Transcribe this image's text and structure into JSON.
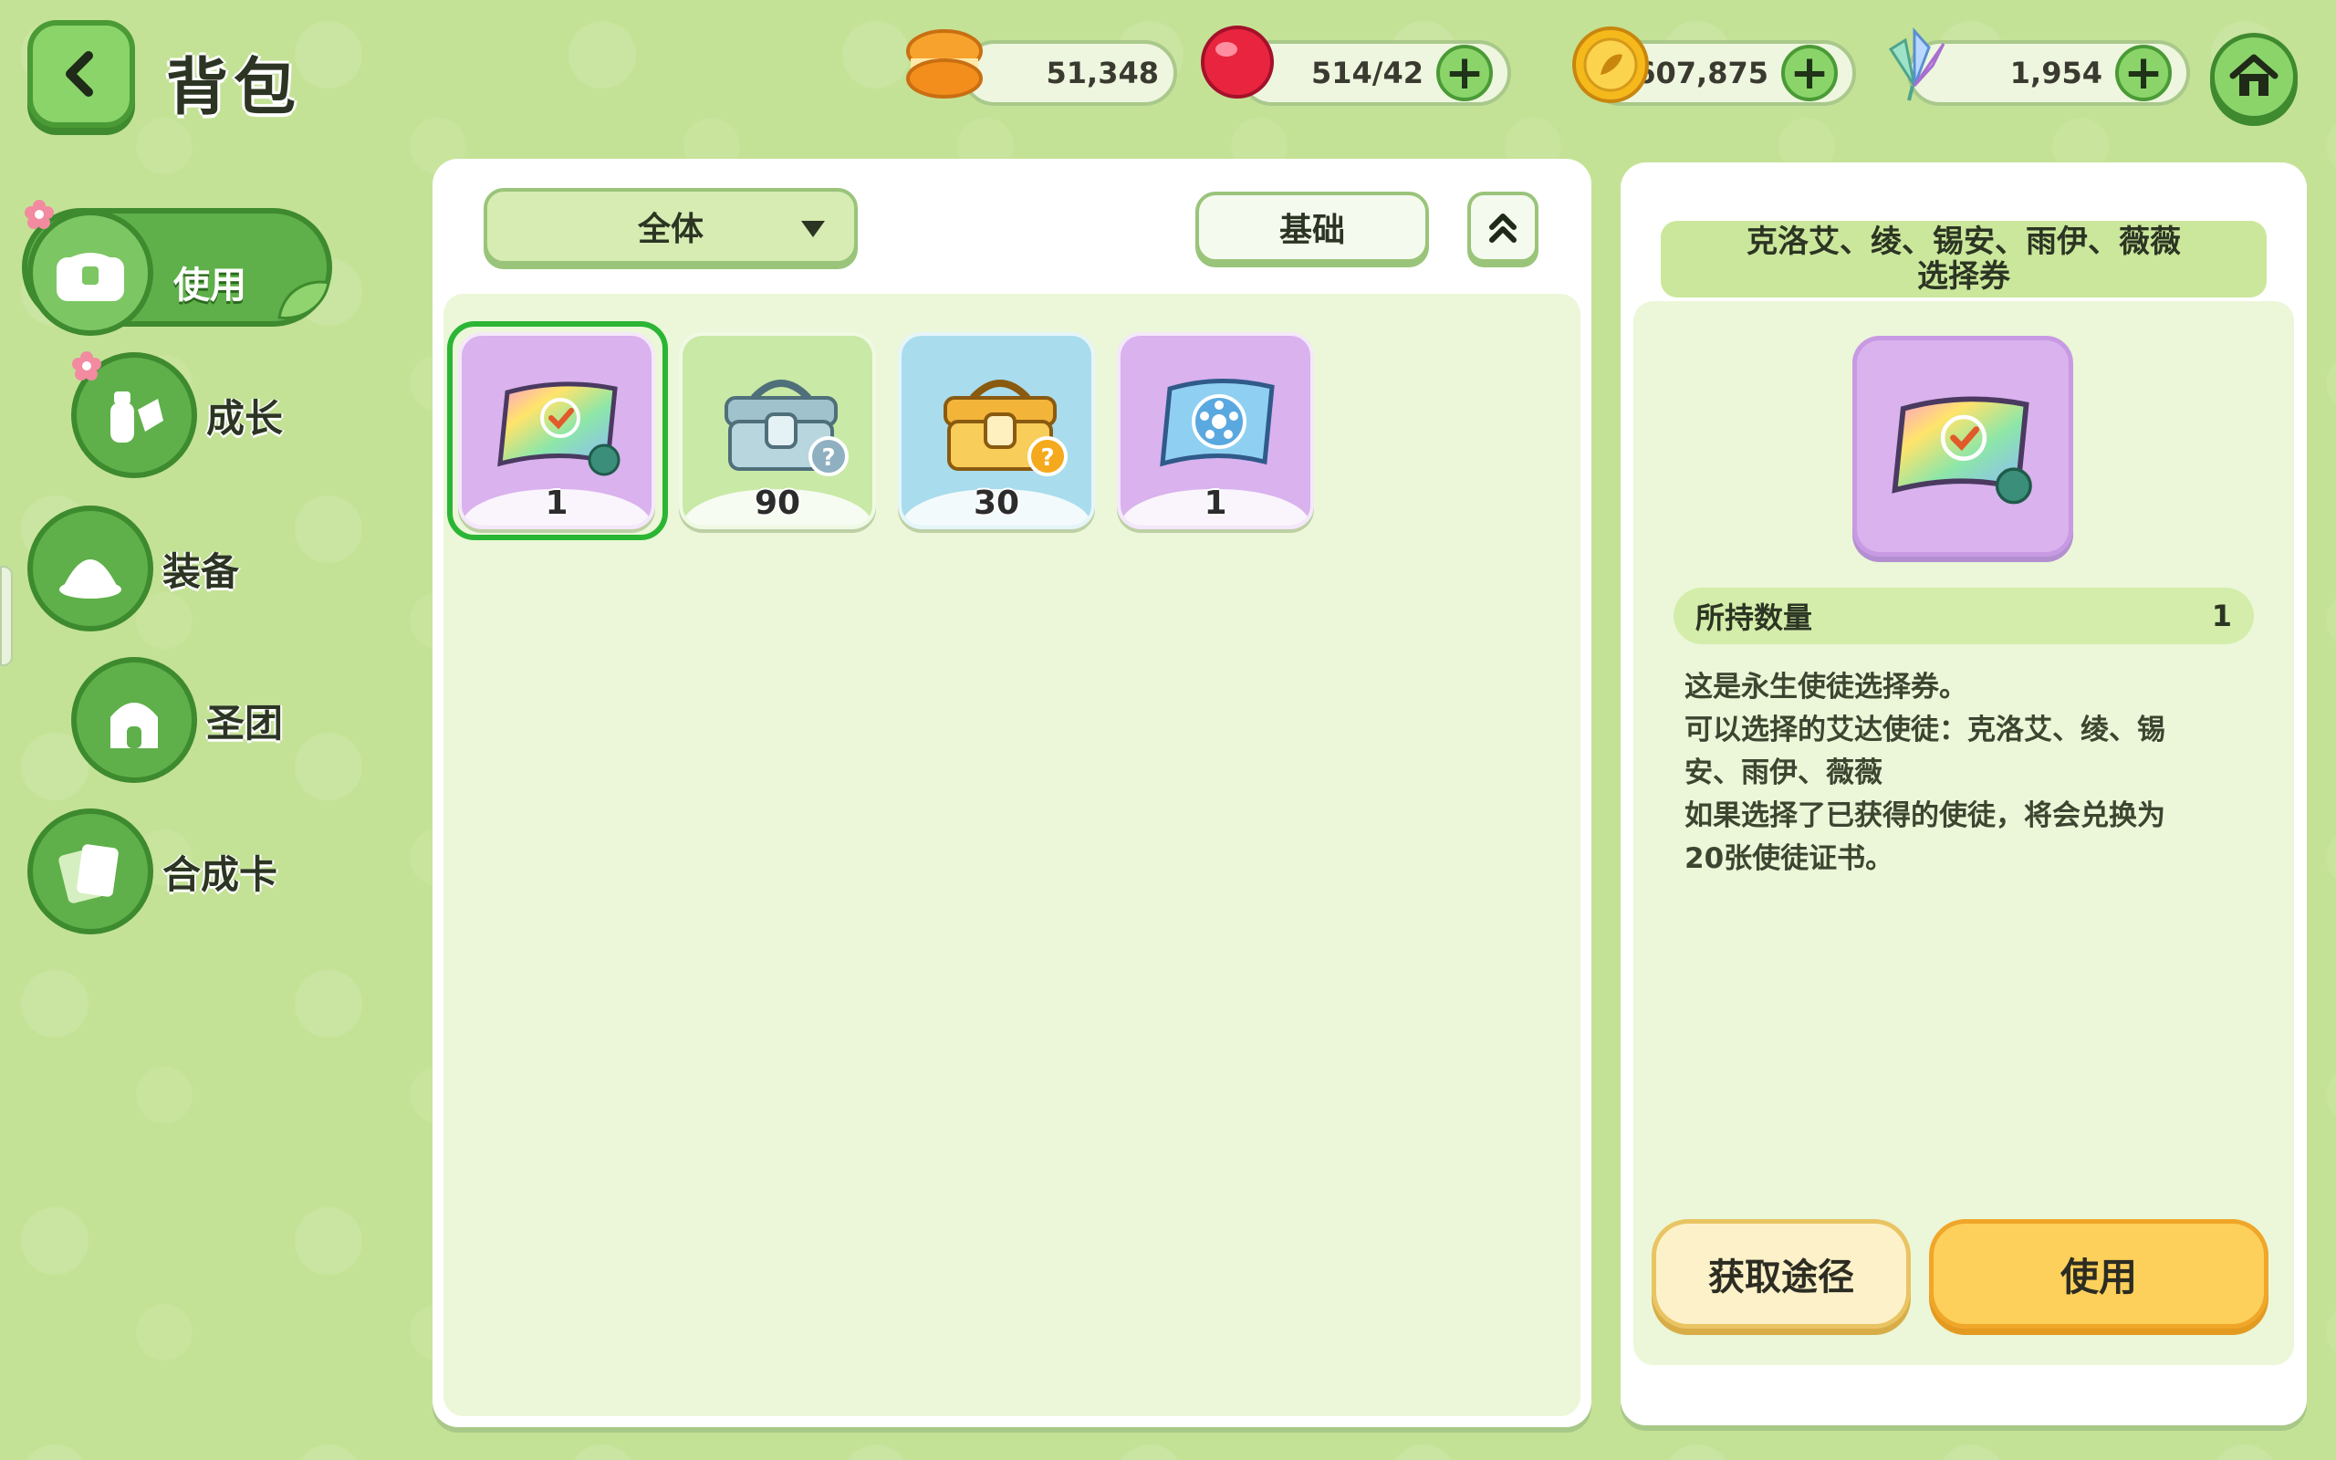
{
  "header": {
    "title": "背包",
    "currencies": [
      {
        "name": "macaron-icon",
        "value": "51,348",
        "has_plus": false
      },
      {
        "name": "candy-icon",
        "value": "514/42",
        "has_plus": true
      },
      {
        "name": "gold-coin-icon",
        "value": "607,875",
        "has_plus": true
      },
      {
        "name": "crystal-flower-icon",
        "value": "1,954",
        "has_plus": true
      }
    ]
  },
  "nav": {
    "items": [
      {
        "label": "使用",
        "active": true
      },
      {
        "label": "成长",
        "active": false
      },
      {
        "label": "装备",
        "active": false
      },
      {
        "label": "圣团",
        "active": false
      },
      {
        "label": "合成卡",
        "active": false
      }
    ]
  },
  "filters": {
    "dropdown_label": "全体",
    "basic_label": "基础"
  },
  "items": [
    {
      "name": "rainbow-ticket",
      "count": "1",
      "bg": "#d9b2ee",
      "selected": true
    },
    {
      "name": "silver-chest",
      "count": "90",
      "bg": "#c9e9a6",
      "selected": false
    },
    {
      "name": "gold-chest",
      "count": "30",
      "bg": "#a9dcec",
      "selected": false
    },
    {
      "name": "blue-ticket",
      "count": "1",
      "bg": "#d9b2ee",
      "selected": false
    }
  ],
  "detail": {
    "title_line1": "克洛艾、绫、锡安、雨伊、薇薇",
    "title_line2": "选择券",
    "qty_label": "所持数量",
    "qty_value": "1",
    "desc1": "这是永生使徒选择券。",
    "desc2": "可以选择的艾达使徒：克洛艾、绫、锡",
    "desc3": "安、雨伊、薇薇",
    "desc4": "如果选择了已获得的使徒，将会兑换为",
    "desc5": "20张使徒证书。",
    "source_btn": "获取途径",
    "use_btn": "使用"
  }
}
